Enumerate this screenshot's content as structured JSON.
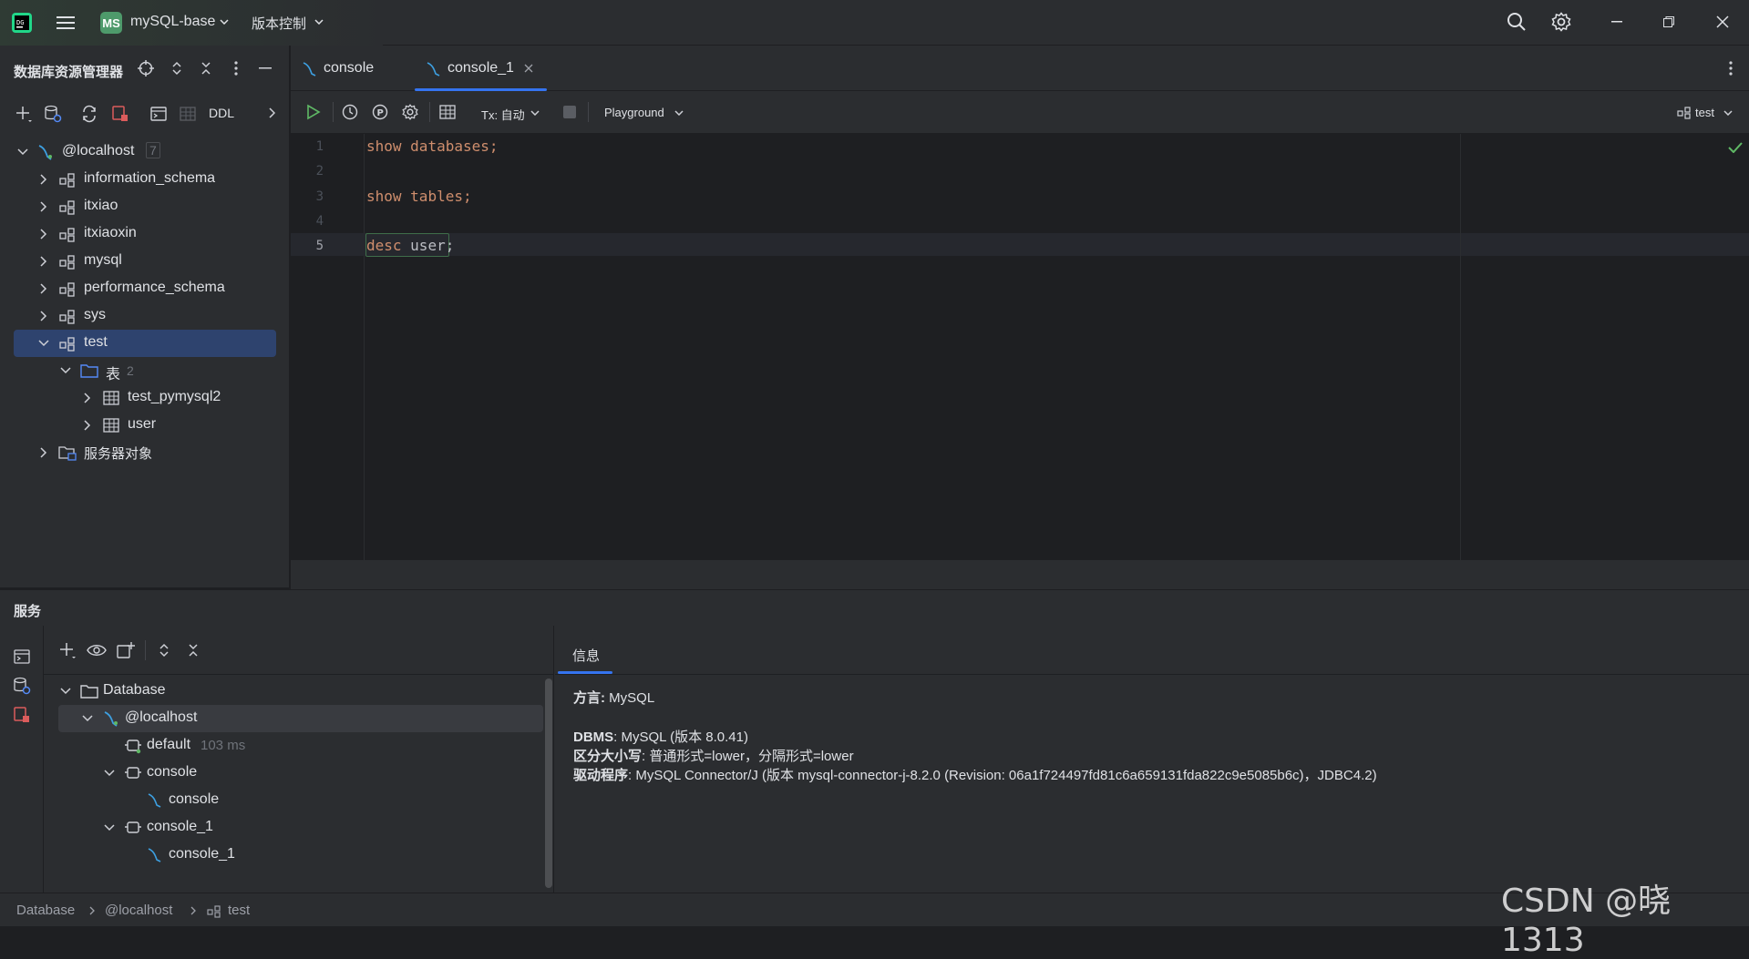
{
  "titlebar": {
    "project_badge": "MS",
    "project_name": "mySQL-base",
    "vcs": "版本控制",
    "icons": [
      "app-logo-icon",
      "main-menu-icon",
      "search-icon",
      "settings-gear-icon",
      "minimize-icon",
      "restore-icon",
      "close-icon"
    ]
  },
  "explorer": {
    "title": "数据库资源管理器",
    "toolbar_ddl": "DDL",
    "tree": [
      {
        "label": "@localhost",
        "count": "7"
      },
      {
        "label": "information_schema"
      },
      {
        "label": "itxiao"
      },
      {
        "label": "itxiaoxin"
      },
      {
        "label": "mysql"
      },
      {
        "label": "performance_schema"
      },
      {
        "label": "sys"
      },
      {
        "label": "test"
      },
      {
        "label": "表",
        "count": "2"
      },
      {
        "label": "test_pymysql2"
      },
      {
        "label": "user"
      },
      {
        "label": "服务器对象"
      }
    ]
  },
  "editor": {
    "tabs": [
      {
        "label": "console"
      },
      {
        "label": "console_1"
      }
    ],
    "tx_label": "Tx: 自动",
    "playground": "Playground",
    "schema": "test",
    "lines": [
      {
        "num": "1",
        "kw": "show",
        "rest": "databases;"
      },
      {
        "num": "2"
      },
      {
        "num": "3",
        "kw": "show",
        "rest": "tables;"
      },
      {
        "num": "4"
      },
      {
        "num": "5",
        "kw": "desc",
        "rest": "user;"
      }
    ],
    "accent": "#3574f0",
    "keyword_color": "#cf8e6d"
  },
  "services": {
    "title": "服务",
    "tree": [
      {
        "label": "Database"
      },
      {
        "label": "@localhost"
      },
      {
        "label": "default",
        "meta": "103 ms"
      },
      {
        "label": "console"
      },
      {
        "label": "console"
      },
      {
        "label": "console_1"
      },
      {
        "label": "console_1"
      }
    ],
    "info_tab": "信息",
    "info": {
      "dialect_key": "方言:",
      "dialect_val": " MySQL",
      "dbms_key": "DBMS",
      "dbms_val": ": MySQL (版本 8.0.41)",
      "case_key": "区分大小写",
      "case_val": ": 普通形式=lower，分隔形式=lower",
      "driver_key": "驱动程序",
      "driver_val": ": MySQL Connector/J (版本 mysql-connector-j-8.2.0 (Revision: 06a1f724497fd81c6a659131fda822c9e5085b6c)，JDBC4.2)"
    }
  },
  "statusbar": {
    "crumbs": [
      "Database",
      "@localhost",
      "test"
    ],
    "watermark": "CSDN @晓1313"
  }
}
